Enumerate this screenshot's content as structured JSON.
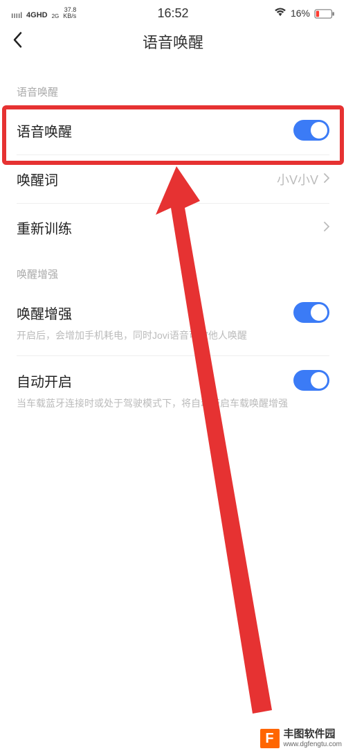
{
  "status": {
    "signal_bars": "ııııl",
    "net_main": "4GHD",
    "net_sub": "2G",
    "speed_top": "37.8",
    "speed_bot": "KB/s",
    "time": "16:52",
    "battery_pct": "16%"
  },
  "header": {
    "title": "语音唤醒"
  },
  "section1": {
    "header": "语音唤醒",
    "voice_wake": {
      "label": "语音唤醒",
      "on": true
    },
    "wake_word": {
      "label": "唤醒词",
      "value": "小V小V"
    },
    "retrain": {
      "label": "重新训练"
    }
  },
  "section2": {
    "header": "唤醒增强",
    "enhance": {
      "label": "唤醒增强",
      "desc": "开启后，会增加手机耗电，同时Jovi语音可被他人唤醒",
      "on": true
    },
    "auto_on": {
      "label": "自动开启",
      "desc": "当车载蓝牙连接时或处于驾驶模式下，将自动开启车载唤醒增强",
      "on": true
    }
  },
  "watermark": {
    "logo_letter": "F",
    "name": "丰图软件园",
    "url": "www.dgfengtu.com"
  },
  "colors": {
    "accent": "#3B7BF6",
    "annotation": "#E63232",
    "battery_low": "#FF3B30"
  }
}
